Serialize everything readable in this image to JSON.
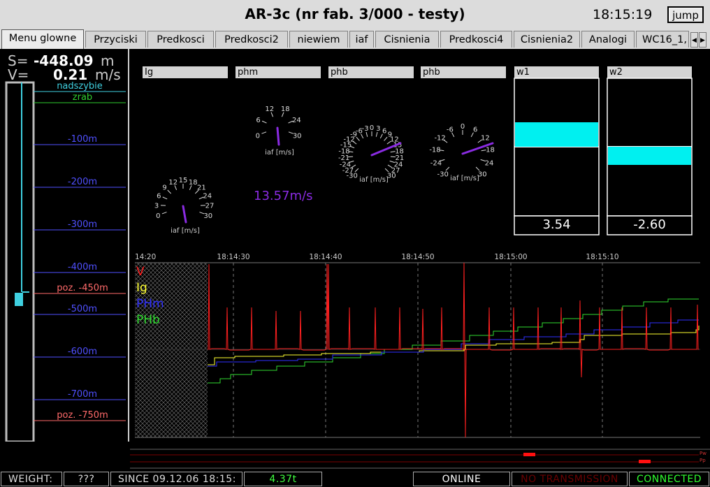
{
  "window": {
    "title": "AR-3c (nr fab. 3/000 - testy)",
    "clock": "18:15:19",
    "jump_label": "jump"
  },
  "tabs": [
    "Menu glowne",
    "Przyciski",
    "Predkosci",
    "Predkosci2",
    "niewiem",
    "iaf",
    "Cisnienia",
    "Predkosci4",
    "Cisnienia2",
    "Analogi",
    "WC16_1,"
  ],
  "active_tab": "Menu glowne",
  "readout": {
    "s_label": "S=",
    "s_value": "-448.09",
    "s_unit": "m",
    "v_label": "V=",
    "v_value": "0.21",
    "v_unit": "m/s"
  },
  "shaft": {
    "top_marks": [
      "nadszybie",
      "zrab"
    ],
    "depth_marks": [
      "-100m",
      "-200m",
      "-300m",
      "-400m",
      "-500m",
      "-600m",
      "-700m"
    ],
    "position_marks": [
      "poz. -450m",
      "poz. -750m"
    ],
    "colors": {
      "nadszybie": "#3fd0e0",
      "zrab": "#30d030",
      "depth": "#5050ff",
      "position": "#ff6a6a"
    }
  },
  "gauge_titles": [
    "Ig",
    "phm",
    "phb",
    "phb",
    "w1",
    "w2"
  ],
  "gauges": [
    {
      "unit": "iaf [m/s]",
      "ticks": [
        "0",
        "3",
        "6",
        "9",
        "12",
        "15",
        "18",
        "21",
        "24",
        "27",
        "30"
      ]
    },
    {
      "unit": "iaf [m/s]",
      "ticks": [
        "0",
        "6",
        "12",
        "18",
        "24",
        "30"
      ]
    },
    {
      "unit": "iaf [m/s]",
      "ticks": [
        "-30",
        "-27",
        "-24",
        "-21",
        "-18",
        "-15",
        "-12",
        "-9",
        "-6",
        "-3",
        "0",
        "3",
        "6",
        "9",
        "12",
        "15",
        "18",
        "21",
        "24",
        "27",
        "30"
      ]
    },
    {
      "unit": "iaf [m/s]",
      "ticks": [
        "-30",
        "-24",
        "-18",
        "-12",
        "-6",
        "0",
        "6",
        "12",
        "18",
        "24",
        "30"
      ]
    }
  ],
  "speed_text": "13.57m/s",
  "bars": [
    {
      "name": "w1",
      "value": "3.54"
    },
    {
      "name": "w2",
      "value": "-2.60"
    }
  ],
  "chart_data": {
    "type": "line",
    "x_ticks": [
      "14:20",
      "18:14:30",
      "18:14:40",
      "18:14:50",
      "18:15:00",
      "18:15:10"
    ],
    "series": [
      {
        "name": "V",
        "color": "#ff2020"
      },
      {
        "name": "Ig",
        "color": "#ffff30"
      },
      {
        "name": "PHm",
        "color": "#3030ff"
      },
      {
        "name": "PHb",
        "color": "#30dd30"
      }
    ],
    "grid": true
  },
  "strip": {
    "labels": [
      "Pw",
      "Pp"
    ]
  },
  "status": {
    "weight_label": "WEIGHT:",
    "weight_value": "???",
    "since_label": "SINCE 09.12.06 18:15:",
    "since_value": "4.37t",
    "online": "ONLINE",
    "transmission": "NO TRANSMISSION",
    "connected": "CONNECTED"
  }
}
